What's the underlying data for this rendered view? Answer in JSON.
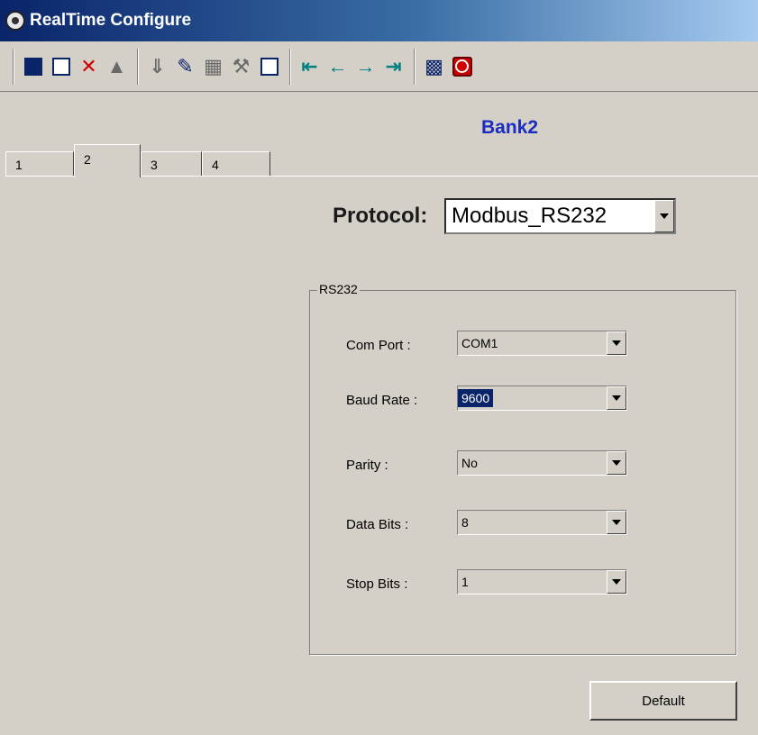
{
  "window": {
    "title": "RealTime Configure",
    "icon": "gear-icon"
  },
  "toolbar": {
    "items": [
      {
        "name": "save-icon",
        "glyph": ""
      },
      {
        "name": "notebook-icon",
        "glyph": ""
      },
      {
        "name": "delete-icon",
        "glyph": "✕"
      },
      {
        "name": "upload-icon",
        "glyph": "▲"
      },
      {
        "name": "download-icon",
        "glyph": "⇓"
      },
      {
        "name": "edit-pencil-icon",
        "glyph": "✎"
      },
      {
        "name": "calculator-icon",
        "glyph": "▦"
      },
      {
        "name": "tools-icon",
        "glyph": "⚒"
      },
      {
        "name": "report-icon",
        "glyph": ""
      },
      {
        "name": "first-icon",
        "glyph": "⇤"
      },
      {
        "name": "previous-icon",
        "glyph": "←"
      },
      {
        "name": "next-icon",
        "glyph": "→"
      },
      {
        "name": "last-icon",
        "glyph": "⇥"
      },
      {
        "name": "qr-icon",
        "glyph": "▩"
      },
      {
        "name": "power-icon",
        "glyph": ""
      }
    ]
  },
  "main": {
    "bank_title": "Bank2",
    "tabs": [
      {
        "label": "1",
        "active": false
      },
      {
        "label": "2",
        "active": true
      },
      {
        "label": "3",
        "active": false
      },
      {
        "label": "4",
        "active": false
      }
    ],
    "protocol": {
      "label": "Protocol:",
      "value": "Modbus_RS232"
    },
    "group": {
      "legend": "RS232",
      "fields": [
        {
          "label": "Com Port :",
          "value": "COM1",
          "selected": false
        },
        {
          "label": "Baud Rate :",
          "value": "9600",
          "selected": true
        },
        {
          "label": "Parity :",
          "value": "No",
          "selected": false
        },
        {
          "label": "Data Bits :",
          "value": "8",
          "selected": false
        },
        {
          "label": "Stop Bits :",
          "value": "1",
          "selected": false
        }
      ]
    },
    "default_button": "Default"
  },
  "colors": {
    "title_bar": "#0a246a",
    "bank_title": "#1a2dbe",
    "selection": "#0a246a",
    "face": "#d4d0c8"
  }
}
